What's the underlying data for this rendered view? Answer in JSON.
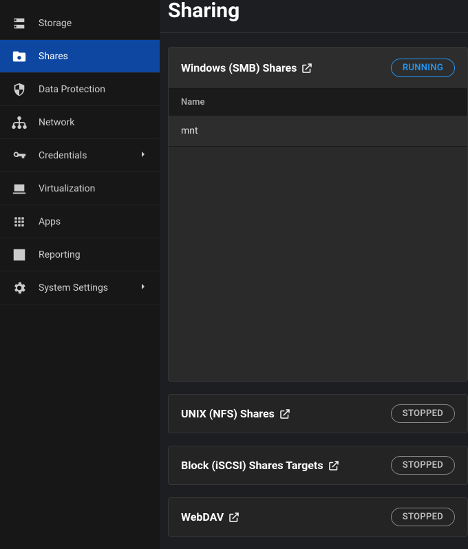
{
  "page": {
    "title": "Sharing"
  },
  "sidebar": {
    "items": [
      {
        "label": "Storage"
      },
      {
        "label": "Shares"
      },
      {
        "label": "Data Protection"
      },
      {
        "label": "Network"
      },
      {
        "label": "Credentials"
      },
      {
        "label": "Virtualization"
      },
      {
        "label": "Apps"
      },
      {
        "label": "Reporting"
      },
      {
        "label": "System Settings"
      }
    ]
  },
  "status": {
    "running": "RUNNING",
    "stopped": "STOPPED"
  },
  "smb": {
    "title": "Windows (SMB) Shares",
    "col_name": "Name",
    "rows": [
      {
        "name": "mnt"
      }
    ]
  },
  "nfs": {
    "title": "UNIX (NFS) Shares"
  },
  "iscsi": {
    "title": "Block (iSCSI) Shares Targets"
  },
  "webdav": {
    "title": "WebDAV"
  }
}
